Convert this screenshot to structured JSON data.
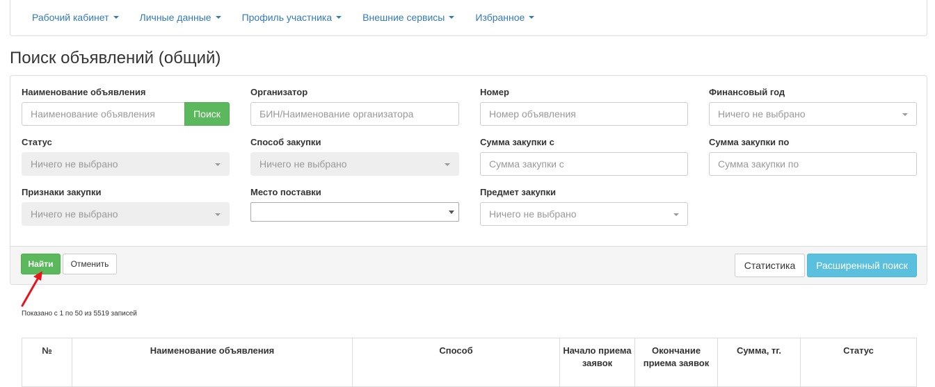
{
  "nav": {
    "items": [
      {
        "label": "Рабочий кабинет"
      },
      {
        "label": "Личные данные"
      },
      {
        "label": "Профиль участника"
      },
      {
        "label": "Внешние сервисы"
      },
      {
        "label": "Избранное"
      }
    ]
  },
  "page": {
    "title": "Поиск объявлений (общий)"
  },
  "filters": {
    "name": {
      "label": "Наименование объявления",
      "placeholder": "Наименование объявления",
      "button": "Поиск"
    },
    "organizer": {
      "label": "Организатор",
      "placeholder": "БИН/Наименование организатора"
    },
    "number": {
      "label": "Номер",
      "placeholder": "Номер объявления"
    },
    "fiscal_year": {
      "label": "Финансовый год",
      "value": "Ничего не выбрано"
    },
    "status": {
      "label": "Статус",
      "value": "Ничего не выбрано"
    },
    "method": {
      "label": "Способ закупки",
      "value": "Ничего не выбрано"
    },
    "sum_from": {
      "label": "Сумма закупки с",
      "placeholder": "Сумма закупки с"
    },
    "sum_to": {
      "label": "Сумма закупки по",
      "placeholder": "Сумма закупки по"
    },
    "features": {
      "label": "Признаки закупки",
      "value": "Ничего не выбрано"
    },
    "delivery_place": {
      "label": "Место поставки",
      "value": ""
    },
    "subject": {
      "label": "Предмет закупки",
      "value": "Ничего не выбрано"
    }
  },
  "actions": {
    "find": "Найти",
    "cancel": "Отменить",
    "statistics": "Статистика",
    "advanced_search": "Расширенный поиск"
  },
  "records_info": "Показано с 1 по 50 из 5519 записей",
  "table": {
    "headers": [
      "№",
      "Наименование объявления",
      "Способ",
      "Начало приема заявок",
      "Окончание приема заявок",
      "Сумма, тг.",
      "Статус"
    ]
  },
  "colors": {
    "link": "#337ab7",
    "success": "#5cb85c",
    "info": "#5bc0de",
    "annotation_arrow": "#e8141b"
  }
}
